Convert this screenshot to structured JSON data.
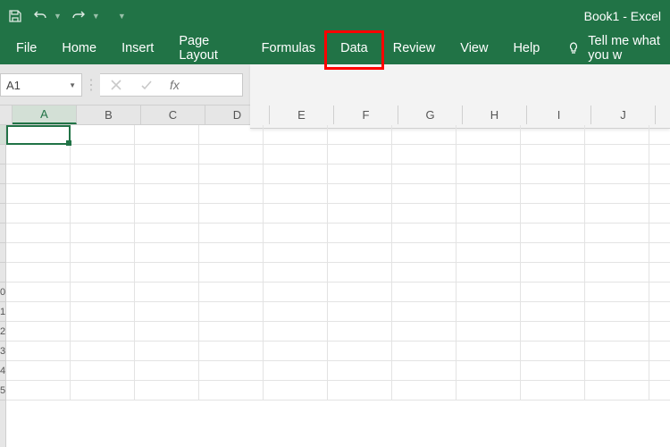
{
  "title": "Book1  -  Excel",
  "quick_access": {
    "save": "save-icon",
    "undo": "undo-icon",
    "redo": "redo-icon"
  },
  "tabs": [
    {
      "label": "File"
    },
    {
      "label": "Home"
    },
    {
      "label": "Insert"
    },
    {
      "label": "Page Layout"
    },
    {
      "label": "Formulas"
    },
    {
      "label": "Data"
    },
    {
      "label": "Review"
    },
    {
      "label": "View"
    },
    {
      "label": "Help"
    }
  ],
  "tellme": {
    "placeholder": "Tell me what you w"
  },
  "name_box": {
    "value": "A1"
  },
  "fx": {
    "label": "fx"
  },
  "columns": [
    "A",
    "B",
    "C",
    "D",
    "E",
    "F",
    "G",
    "H",
    "I",
    "J"
  ],
  "rows": [
    "",
    "",
    "",
    "",
    "",
    "",
    "",
    "",
    "0",
    "1",
    "2",
    "3",
    "4",
    "5"
  ],
  "selected": {
    "col": "A",
    "row_index": 0
  },
  "highlight_tab_index": 5
}
